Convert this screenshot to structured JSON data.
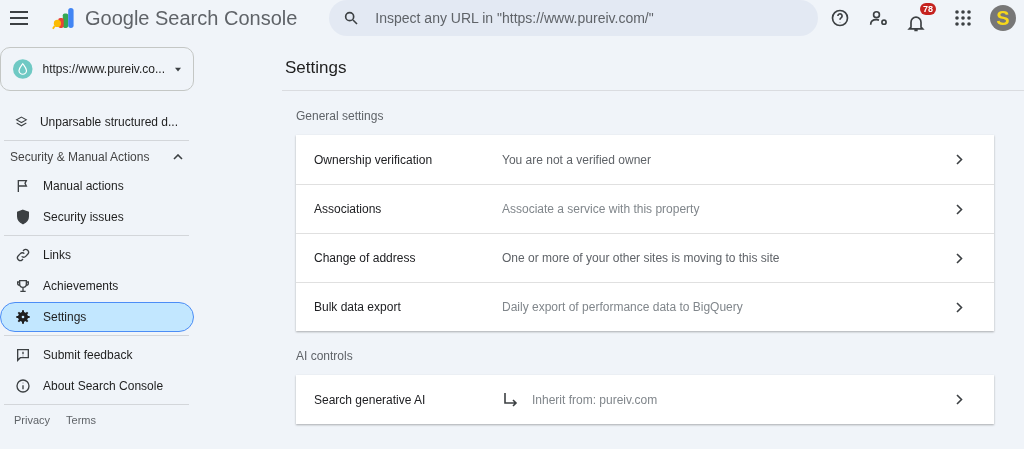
{
  "header": {
    "product": "Google Search Console",
    "search": {
      "placeholder": "Inspect any URL in \"https://www.pureiv.com/\""
    },
    "notifications": {
      "count": "78"
    },
    "avatar": {
      "letter": "S"
    }
  },
  "property": {
    "label": "https://www.pureiv.co..."
  },
  "sidebar": {
    "groups": [
      {
        "items": [
          {
            "label": "Unparsable structured d...",
            "selected": false
          }
        ]
      },
      {
        "heading": "Security & Manual Actions",
        "expanded": true,
        "items": [
          {
            "label": "Manual actions",
            "selected": false
          },
          {
            "label": "Security issues",
            "selected": false
          }
        ]
      },
      {
        "items": [
          {
            "label": "Links",
            "selected": false
          },
          {
            "label": "Achievements",
            "selected": false
          },
          {
            "label": "Settings",
            "selected": true
          }
        ]
      },
      {
        "items": [
          {
            "label": "Submit feedback",
            "selected": false
          },
          {
            "label": "About Search Console",
            "selected": false
          }
        ]
      }
    ],
    "footer": [
      "Privacy",
      "Terms"
    ]
  },
  "page": {
    "title": "Settings",
    "sections": [
      {
        "heading": "General settings",
        "rows": [
          {
            "label": "Ownership verification",
            "value": "You are not a verified owner",
            "muted": false
          },
          {
            "label": "Associations",
            "value": "Associate a service with this property",
            "muted": true
          },
          {
            "label": "Change of address",
            "value": "One or more of your other sites is moving to this site",
            "muted": false
          },
          {
            "label": "Bulk data export",
            "value": "Daily export of performance data to BigQuery",
            "muted": true
          }
        ]
      },
      {
        "heading": "AI controls",
        "rows": [
          {
            "label": "Search generative AI",
            "value": "Inherit from: pureiv.com",
            "muted": true,
            "inherit": true
          }
        ]
      }
    ]
  }
}
